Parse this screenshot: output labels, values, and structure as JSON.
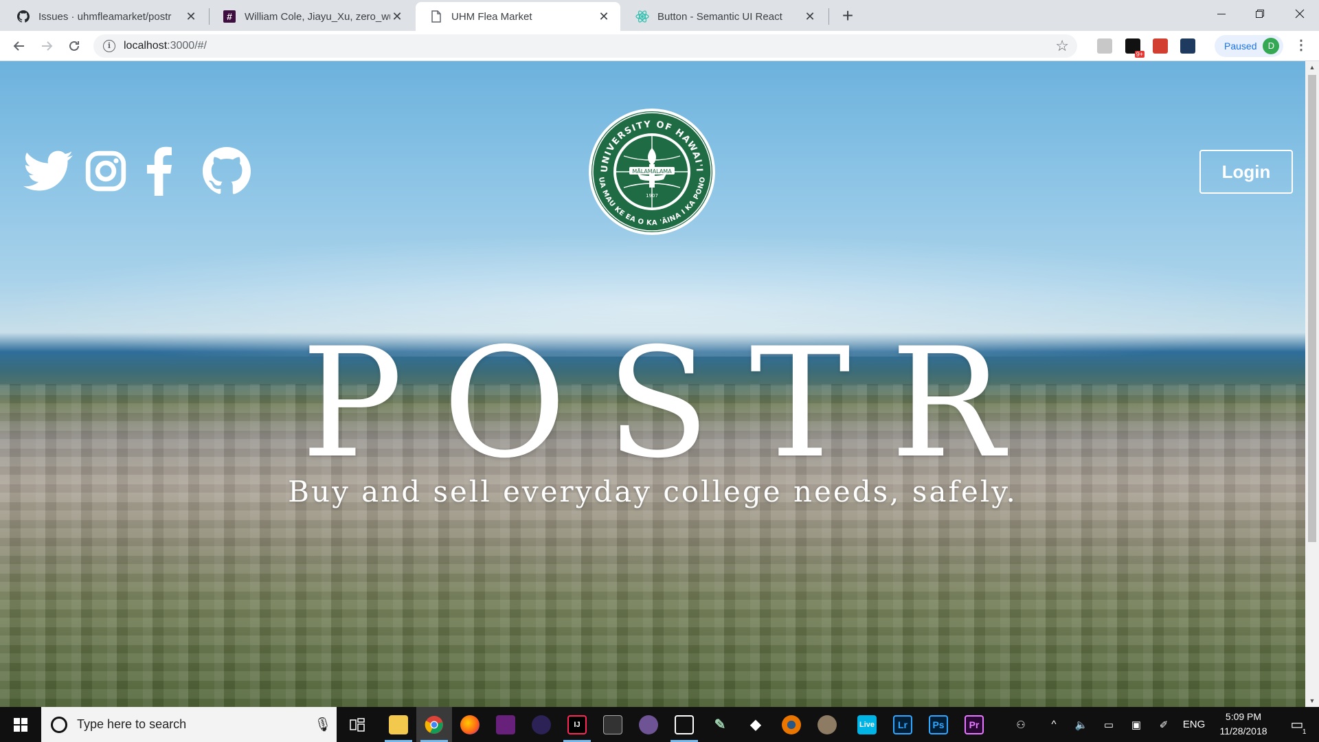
{
  "browser": {
    "tabs": [
      {
        "title": "Issues · uhmfleamarket/postr",
        "icon": "github-icon",
        "active": false
      },
      {
        "title": "William Cole, Jiayu_Xu, zero_wu, ...",
        "icon": "slack-hash-icon",
        "active": false
      },
      {
        "title": "UHM Flea Market",
        "icon": "page-icon",
        "active": true
      },
      {
        "title": "Button - Semantic UI React",
        "icon": "react-icon",
        "active": false
      }
    ],
    "url_host": "localhost",
    "url_rest": ":3000/#/",
    "profile_status": "Paused",
    "profile_initial": "D",
    "extension_badge": "9+"
  },
  "page": {
    "social_links": [
      {
        "name": "twitter-icon"
      },
      {
        "name": "instagram-icon"
      },
      {
        "name": "facebook-icon"
      },
      {
        "name": "github-icon"
      }
    ],
    "seal": {
      "top_text": "UNIVERSITY OF HAWAI'I",
      "bottom_text": "UA MAU KE EA O KA 'ĀINA I KA PONO",
      "banner": "MĀLAMALAMA",
      "year": "1907"
    },
    "login_label": "Login",
    "title": "POSTR",
    "tagline": "Buy and sell everyday college needs, safely."
  },
  "taskbar": {
    "search_placeholder": "Type here to search",
    "language": "ENG",
    "time": "5:09 PM",
    "date": "11/28/2018",
    "notification_count": "1",
    "apps": [
      {
        "name": "task-view-icon",
        "label": ""
      },
      {
        "name": "file-explorer-icon",
        "label": ""
      },
      {
        "name": "chrome-icon",
        "label": ""
      },
      {
        "name": "firefox-icon",
        "label": ""
      },
      {
        "name": "visual-studio-icon",
        "label": ""
      },
      {
        "name": "eclipse-icon",
        "label": ""
      },
      {
        "name": "intellij-icon",
        "label": ""
      },
      {
        "name": "terminal-icon",
        "label": ""
      },
      {
        "name": "github-desktop-icon",
        "label": ""
      },
      {
        "name": "eclipse-ide-icon",
        "label": ""
      },
      {
        "name": "inkscape-icon",
        "label": ""
      },
      {
        "name": "unity-icon",
        "label": ""
      },
      {
        "name": "blender-icon",
        "label": ""
      },
      {
        "name": "gimp-icon",
        "label": ""
      },
      {
        "name": "live-icon",
        "label": "Live"
      },
      {
        "name": "lightroom-icon",
        "label": "Lr"
      },
      {
        "name": "photoshop-icon",
        "label": "Ps"
      },
      {
        "name": "premiere-icon",
        "label": "Pr"
      }
    ]
  },
  "colors": {
    "seal_green": "#1f6b44",
    "accent_blue": "#1a73e8",
    "taskbar": "#101010"
  }
}
